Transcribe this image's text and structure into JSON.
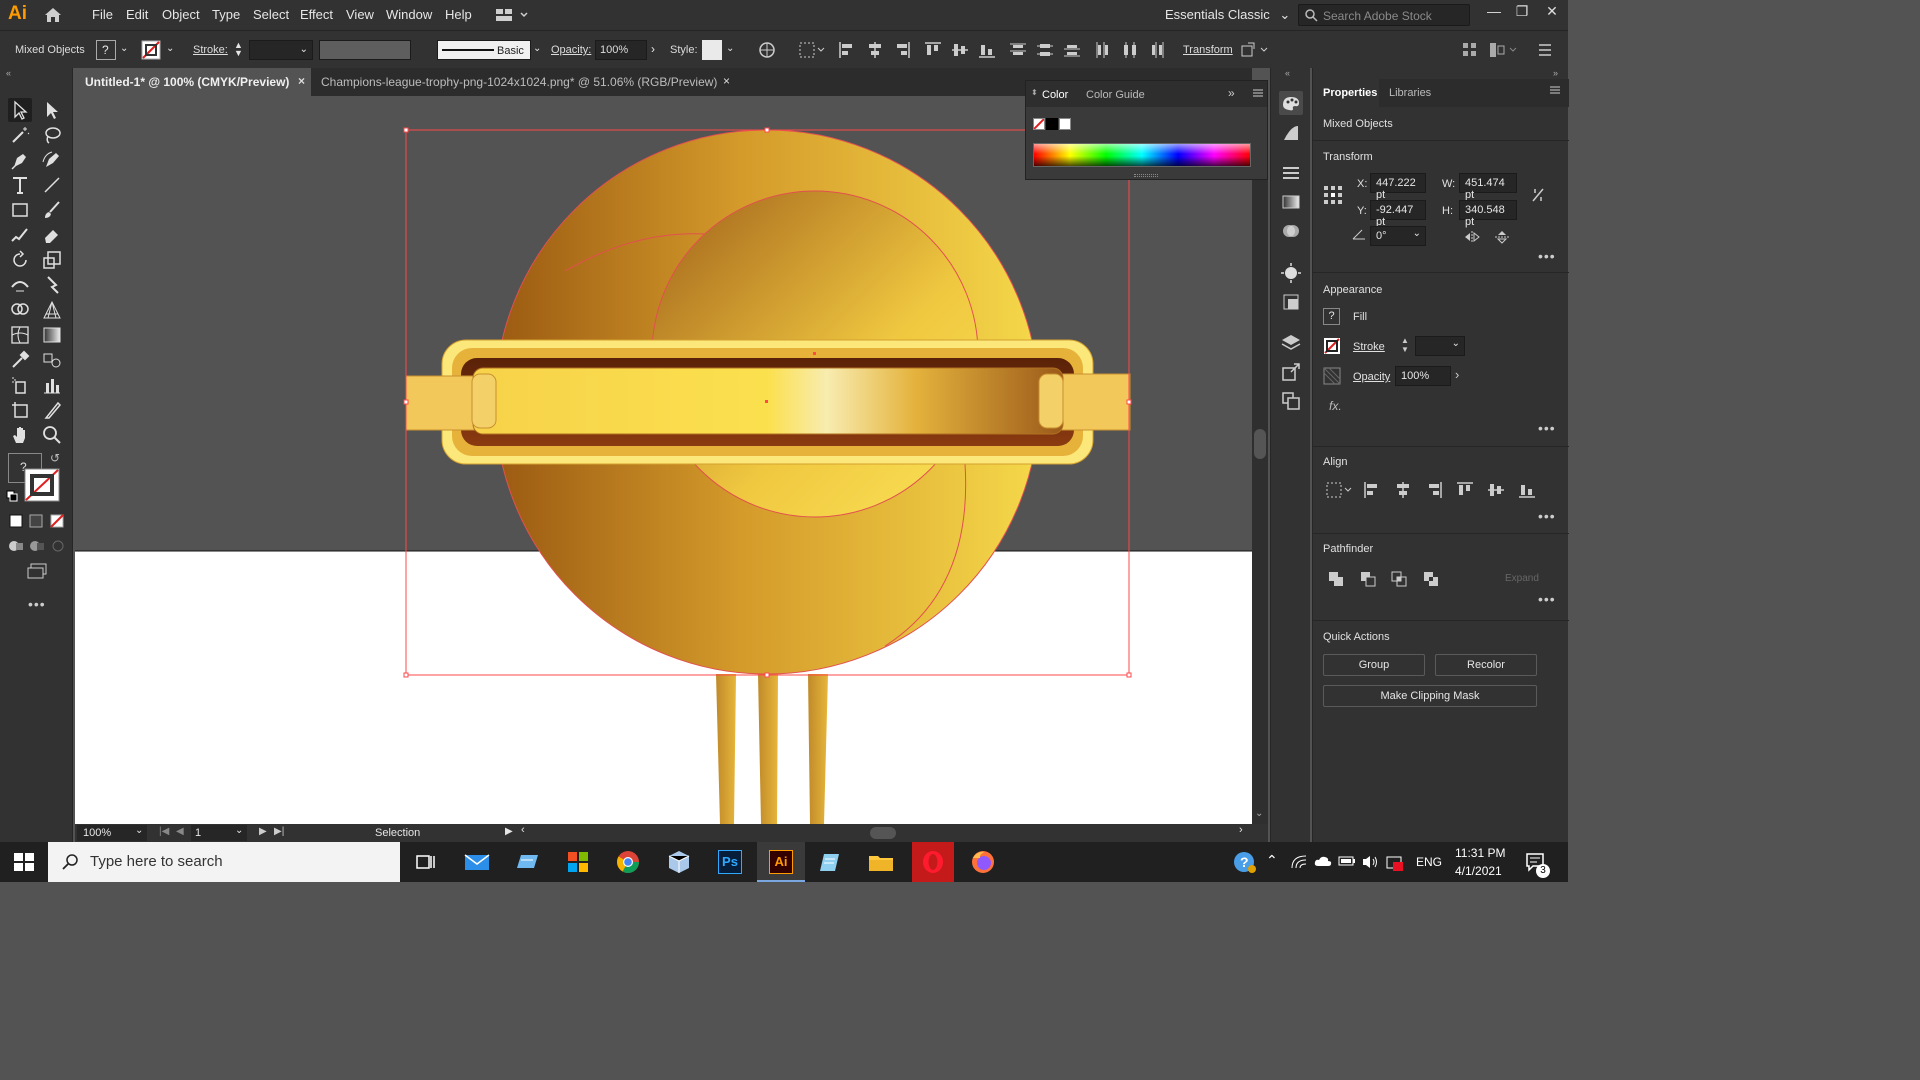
{
  "app": {
    "logo": "Ai",
    "menus": [
      "File",
      "Edit",
      "Object",
      "Type",
      "Select",
      "Effect",
      "View",
      "Window",
      "Help"
    ],
    "workspace": "Essentials Classic",
    "search_placeholder": "Search Adobe Stock"
  },
  "control_bar": {
    "selection_label": "Mixed Objects",
    "fill_question": "?",
    "stroke_label": "Stroke:",
    "brush_label": "Basic",
    "opacity_label": "Opacity:",
    "opacity_value": "100%",
    "style_label": "Style:",
    "transform_label": "Transform"
  },
  "tabs": [
    {
      "label": "Untitled-1* @ 100% (CMYK/Preview)",
      "close": "×"
    },
    {
      "label": "Champions-league-trophy-png-1024x1024.png* @ 51.06% (RGB/Preview)",
      "close": "×"
    }
  ],
  "status_bar": {
    "zoom": "100%",
    "artboard": "1",
    "tool": "Selection"
  },
  "color_panel": {
    "tabs": [
      "Color",
      "Color Guide"
    ]
  },
  "properties": {
    "tabs": [
      "Properties",
      "Libraries"
    ],
    "selection": "Mixed Objects",
    "transform_title": "Transform",
    "x_label": "X:",
    "x_value": "447.222 pt",
    "y_label": "Y:",
    "y_value": "-92.447 pt",
    "w_label": "W:",
    "w_value": "451.474 pt",
    "h_label": "H:",
    "h_value": "340.548 pt",
    "angle_value": "0°",
    "appearance_title": "Appearance",
    "fill_question": "?",
    "fill_label": "Fill",
    "stroke_label": "Stroke",
    "opacity_label": "Opacity",
    "opacity_value": "100%",
    "fx_label": "fx.",
    "align_title": "Align",
    "pathfinder_title": "Pathfinder",
    "expand_label": "Expand",
    "quick_actions_title": "Quick Actions",
    "group_button": "Group",
    "recolor_button": "Recolor",
    "clipping_mask_button": "Make Clipping Mask"
  },
  "taskbar": {
    "search_placeholder": "Type here to search",
    "language": "ENG",
    "time": "11:31 PM",
    "date": "4/1/2021",
    "notification_count": "3",
    "ps_label": "Ps",
    "ai_label": "Ai"
  },
  "colors": {
    "accent_selection": "#ff4a4a",
    "gold_dark": "#9b5a12",
    "gold_light": "#f8df4a"
  }
}
